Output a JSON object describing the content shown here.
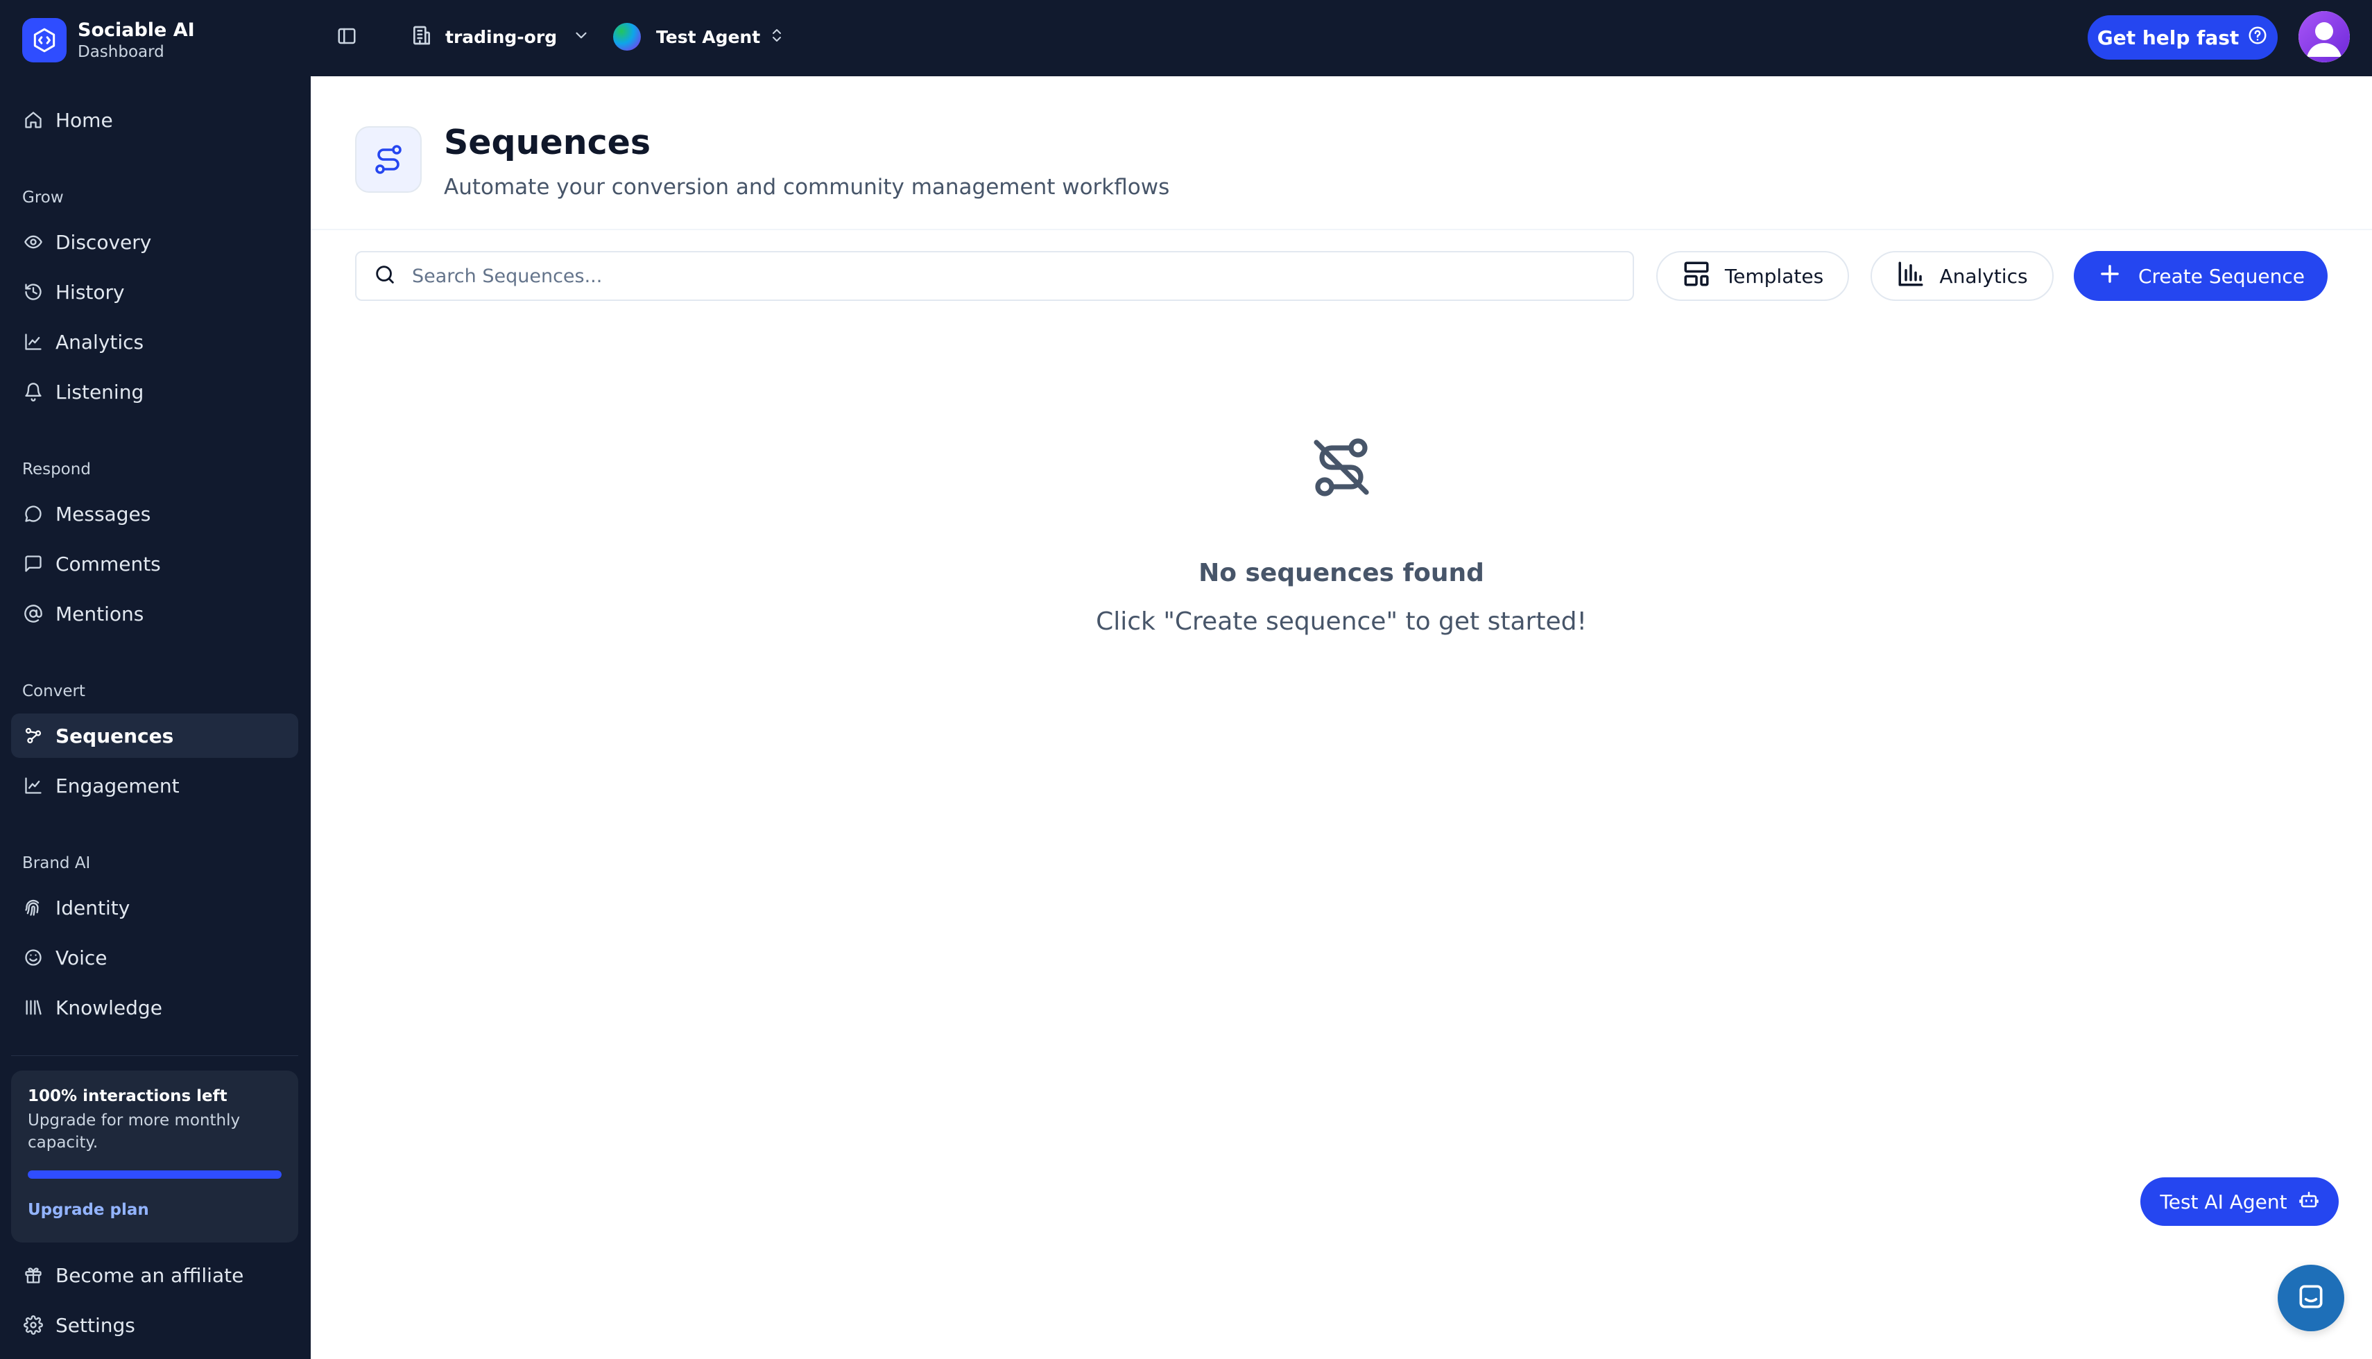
{
  "brand": {
    "name": "Sociable AI",
    "subtitle": "Dashboard"
  },
  "topbar": {
    "org_name": "trading-org",
    "agent_name": "Test Agent",
    "help_label": "Get help fast"
  },
  "sidebar": {
    "home": "Home",
    "sections": [
      {
        "label": "Grow",
        "items": [
          "Discovery",
          "History",
          "Analytics",
          "Listening"
        ]
      },
      {
        "label": "Respond",
        "items": [
          "Messages",
          "Comments",
          "Mentions"
        ]
      },
      {
        "label": "Convert",
        "items": [
          "Sequences",
          "Engagement"
        ]
      },
      {
        "label": "Brand AI",
        "items": [
          "Identity",
          "Voice",
          "Knowledge"
        ]
      }
    ],
    "active_item": "Sequences",
    "upgrade": {
      "title": "100% interactions left",
      "description": "Upgrade for more monthly capacity.",
      "progress_percent": 100,
      "link": "Upgrade plan"
    },
    "footer": [
      "Become an affiliate",
      "Settings"
    ]
  },
  "main": {
    "title": "Sequences",
    "subtitle": "Automate your conversion and community management workflows",
    "search_placeholder": "Search Sequences...",
    "buttons": {
      "templates": "Templates",
      "analytics": "Analytics",
      "create": "Create Sequence"
    },
    "empty": {
      "title": "No sequences found",
      "subtitle": "Click \"Create sequence\" to get started!"
    }
  },
  "floating": {
    "test_agent": "Test AI Agent"
  },
  "colors": {
    "sidebar_bg": "#111a2e",
    "accent": "#2546f0",
    "active_item_bg": "#1f2a40"
  }
}
